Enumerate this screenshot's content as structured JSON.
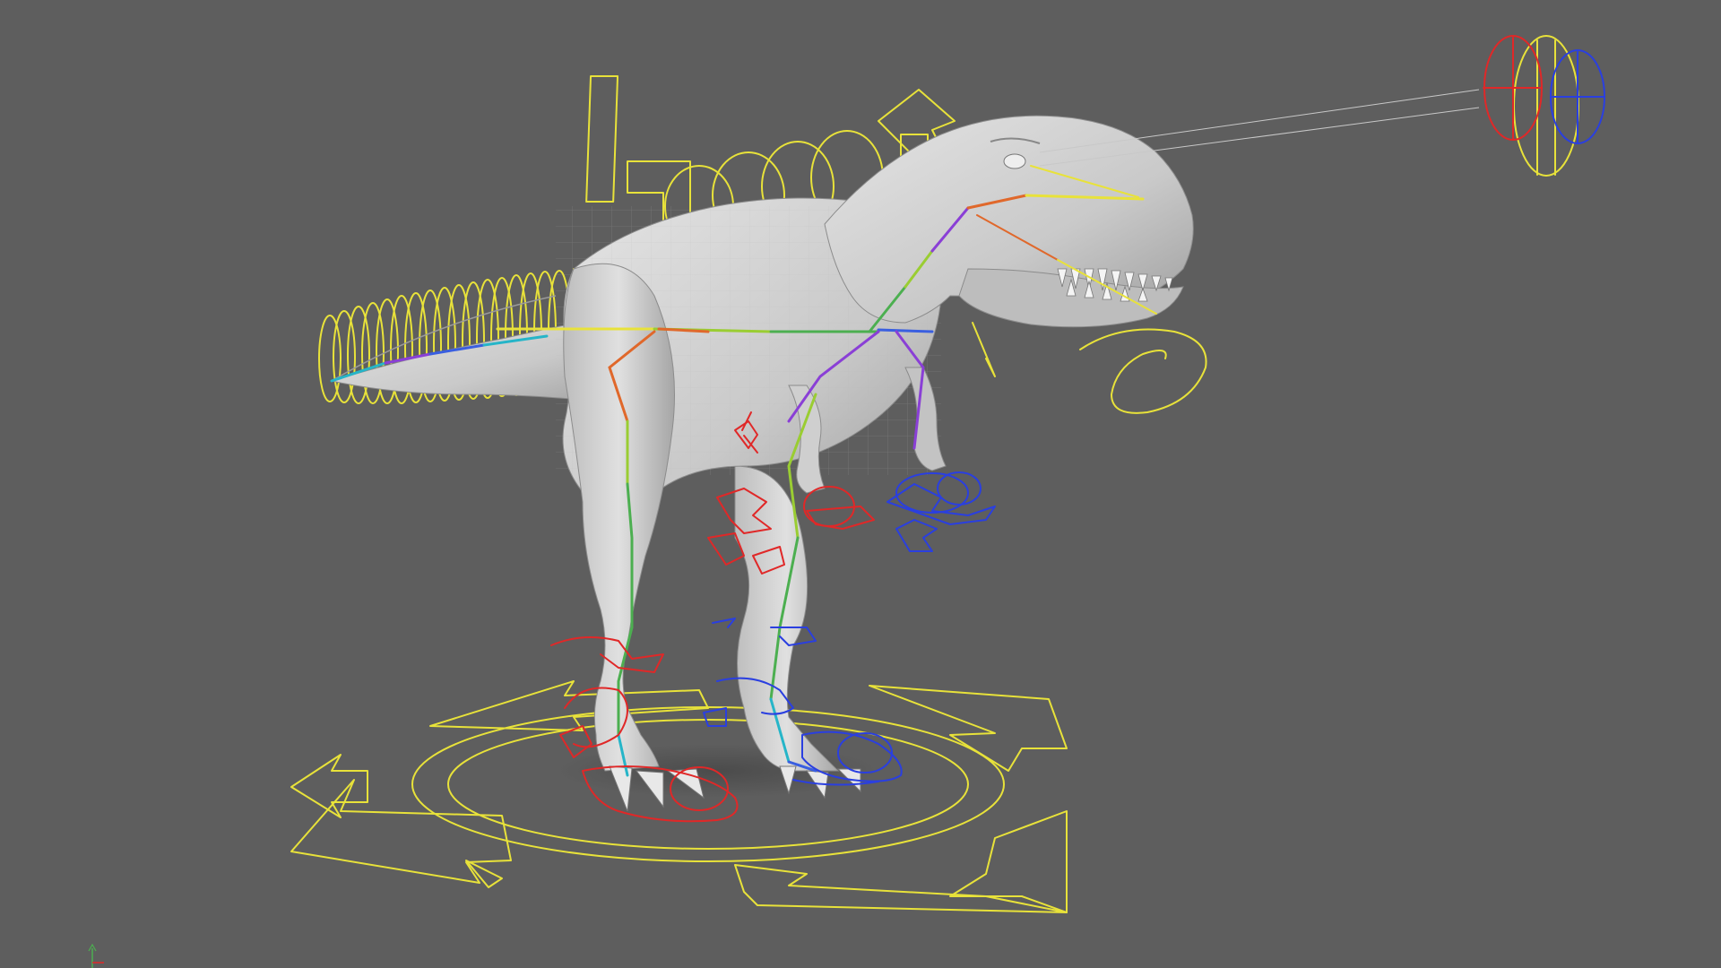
{
  "viewport": {
    "background": "#5e5e5e",
    "colors": {
      "center_control": "#e8e23a",
      "left_control": "#e02828",
      "right_control": "#2a3fe0",
      "mesh_fill": "#d2d2d2",
      "mesh_shadow": "#a9a9a9",
      "eye_aim_line": "#c8c8c8"
    },
    "skeleton_colors": [
      "#e8e23a",
      "#9acd32",
      "#4caf50",
      "#26b5c8",
      "#3a5fe0",
      "#8a3fd6",
      "#e0459a",
      "#e0682b",
      "#b87333"
    ],
    "objects": [
      "trex-mesh",
      "spine-skeleton",
      "neck-head-skeleton",
      "tail-fk-controls",
      "back-fk-controls",
      "global-move-control",
      "eye-aim-control",
      "left-foot-ik-control",
      "right-foot-ik-control",
      "left-arm-controls",
      "right-arm-controls",
      "jaw-control"
    ],
    "axis_icon": "view-axis-icon"
  }
}
